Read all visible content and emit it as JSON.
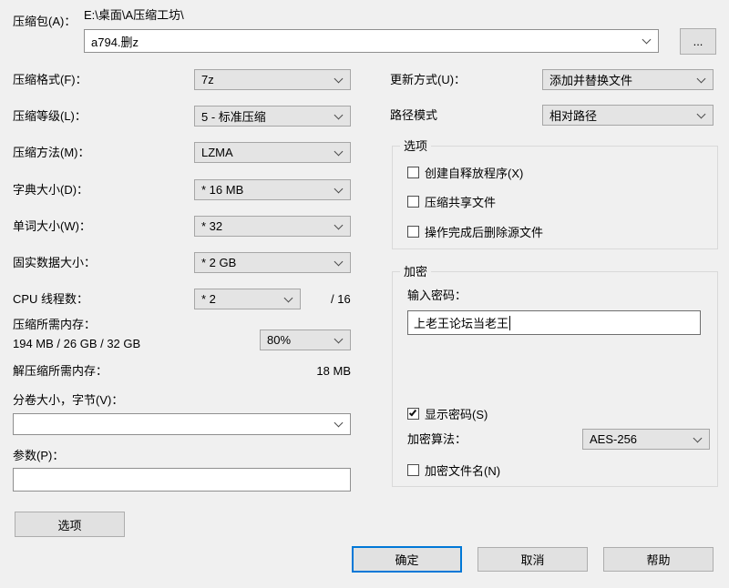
{
  "window": {
    "bg": "#f0f0f0",
    "accent": "#0078d7"
  },
  "archive": {
    "label": "压缩包(A)：",
    "dir_path": "E:\\桌面\\A压缩工坊\\",
    "name": "a794.删z",
    "browse": "..."
  },
  "left": {
    "format": {
      "label": "压缩格式(F)：",
      "value": "7z"
    },
    "level": {
      "label": "压缩等级(L)：",
      "value": "5 - 标准压缩"
    },
    "method": {
      "label": "压缩方法(M)：",
      "value": "LZMA"
    },
    "dict": {
      "label": "字典大小(D)：",
      "value": "* 16 MB"
    },
    "word": {
      "label": "单词大小(W)：",
      "value": "* 32"
    },
    "solid": {
      "label": "固实数据大小：",
      "value": "* 2 GB"
    },
    "cpu": {
      "label": "CPU 线程数：",
      "value": "* 2",
      "max": "/ 16"
    },
    "mem_compress": {
      "label": "压缩所需内存：",
      "value": "194 MB / 26 GB / 32 GB",
      "percent": "80%"
    },
    "mem_decompress": {
      "label": "解压缩所需内存：",
      "value": "18 MB"
    },
    "volume": {
      "label": "分卷大小，字节(V)：",
      "value": ""
    },
    "params": {
      "label": "参数(P)：",
      "value": ""
    },
    "options_button": "选项"
  },
  "right": {
    "update_mode": {
      "label": "更新方式(U)：",
      "value": "添加并替换文件"
    },
    "path_mode": {
      "label": "路径模式",
      "value": "相对路径"
    },
    "options": {
      "title": "选项",
      "sfx": "创建自释放程序(X)",
      "shared": "压缩共享文件",
      "delete_after": "操作完成后删除源文件"
    },
    "encryption": {
      "title": "加密",
      "password_label": "输入密码：",
      "password": "上老王论坛当老王",
      "show_password": "显示密码(S)",
      "method_label": "加密算法：",
      "method": "AES-256",
      "encrypt_names": "加密文件名(N)"
    }
  },
  "footer": {
    "ok": "确定",
    "cancel": "取消",
    "help": "帮助"
  }
}
